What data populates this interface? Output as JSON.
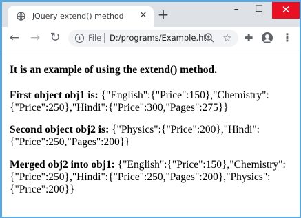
{
  "browser": {
    "tab_title": "jQuery extend() method",
    "tab_close": "✕",
    "new_tab": "+",
    "window_controls": {
      "minimize": "–",
      "maximize": "☐",
      "close": "✕"
    },
    "scheme_label": "File",
    "url": "D:/programs/Example.html",
    "icons": [
      "globe-icon",
      "info-icon",
      "zoom-icon",
      "star-icon",
      "puzzle-icon",
      "profile-icon",
      "menu-icon"
    ]
  },
  "page": {
    "intro": "It is an example of using the extend() method.",
    "obj1_label": "First object obj1 is:",
    "obj1_value": "{\"English\":{\"Price\":150},\"Chemistry\":{\"Price\":250},\"Hindi\":{\"Price\":300,\"Pages\":275}}",
    "obj2_label": "Second object obj2 is:",
    "obj2_value": "{\"Physics\":{\"Price\":200},\"Hindi\":{\"Price\":250,\"Pages\":200}}",
    "merged_label": "Merged obj2 into obj1:",
    "merged_value": "{\"English\":{\"Price\":150},\"Chemistry\":{\"Price\":250},\"Hindi\":{\"Price\":250,\"Pages\":200},\"Physics\":{\"Price\":200}}"
  }
}
